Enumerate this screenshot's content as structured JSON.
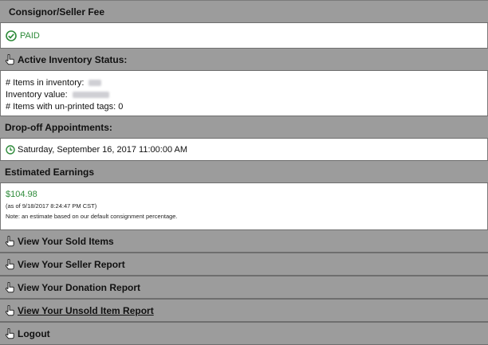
{
  "consignor_fee": {
    "header": "Consignor/Seller Fee",
    "status": "PAID",
    "status_color": "#2e8b3a"
  },
  "inventory": {
    "header": "Active Inventory Status:",
    "items_label": "# Items in inventory:",
    "value_label": "Inventory value:",
    "unprinted_label": "# Items with un-printed tags:",
    "unprinted_value": "0"
  },
  "dropoff": {
    "header": "Drop-off Appointments:",
    "appointment": "Saturday, September 16, 2017 11:00:00 AM"
  },
  "earnings": {
    "header": "Estimated Earnings",
    "amount": "$104.98",
    "as_of": "(as of 9/18/2017 8:24:47 PM CST)",
    "note": "Note: an estimate based on our default consignment percentage."
  },
  "links": {
    "sold_items": "View Your Sold Items",
    "seller_report": "View Your Seller Report",
    "donation_report": "View Your Donation Report",
    "unsold_report": "View Your Unsold Item Report",
    "logout": "Logout"
  },
  "icons": {
    "paid": "check-circle-icon",
    "inventory": "hand-pointer-icon",
    "appointment": "clock-icon"
  },
  "colors": {
    "header_bg": "#9c9c9c",
    "accent_green": "#2e8b3a"
  }
}
